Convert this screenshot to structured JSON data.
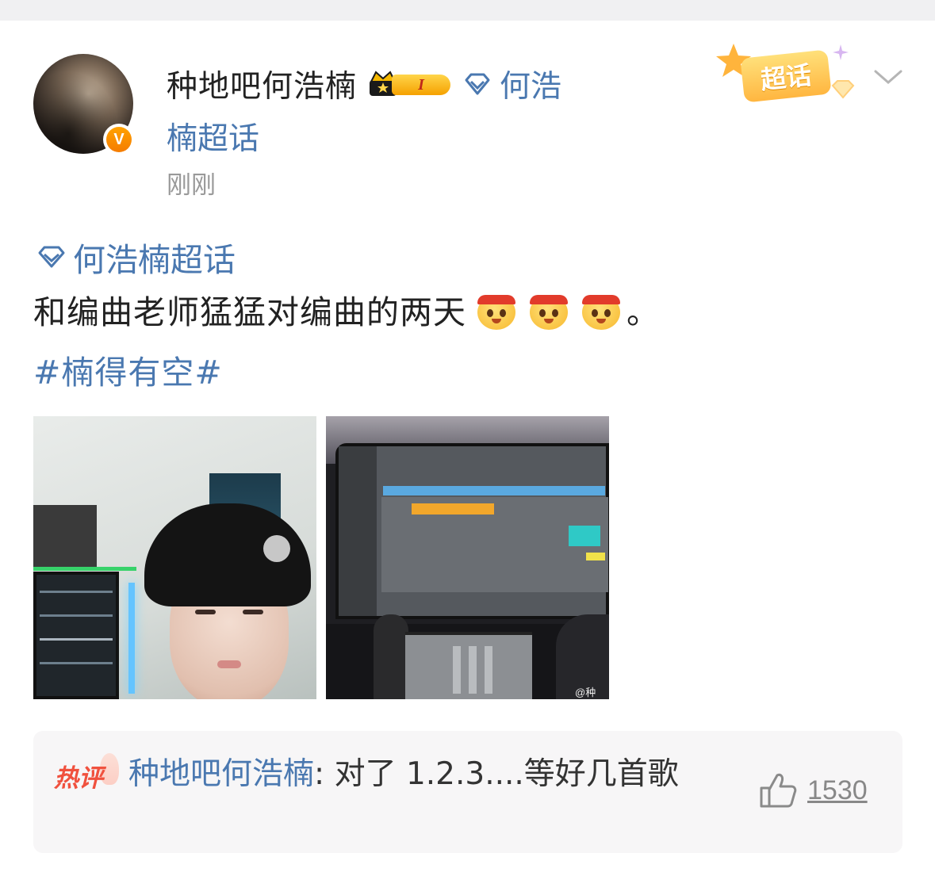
{
  "post": {
    "username": "种地吧何浩楠",
    "level_badge": "I",
    "super_topic_part1": "何浩",
    "super_topic_part2": "楠超话",
    "timestamp": "刚刚",
    "chaohua_badge": "超话",
    "topic_link": "何浩楠超话",
    "body_text": "和编曲老师猛猛对编曲的两天",
    "body_end": "。",
    "hashtag": "#楠得有空#",
    "emojis": [
      "cheer-emoji",
      "cheer-emoji",
      "cheer-emoji"
    ],
    "watermark": "@种"
  },
  "hot_comment": {
    "tag": "热评",
    "author": "种地吧何浩楠",
    "separator": ": ",
    "text": "对了 1.2.3....等好几首歌",
    "likes": "1530"
  },
  "colors": {
    "link_blue": "#4a78b0",
    "hot_red": "#f0513e",
    "verified_orange": "#f57c00",
    "badge_gold": "#f5a100"
  }
}
